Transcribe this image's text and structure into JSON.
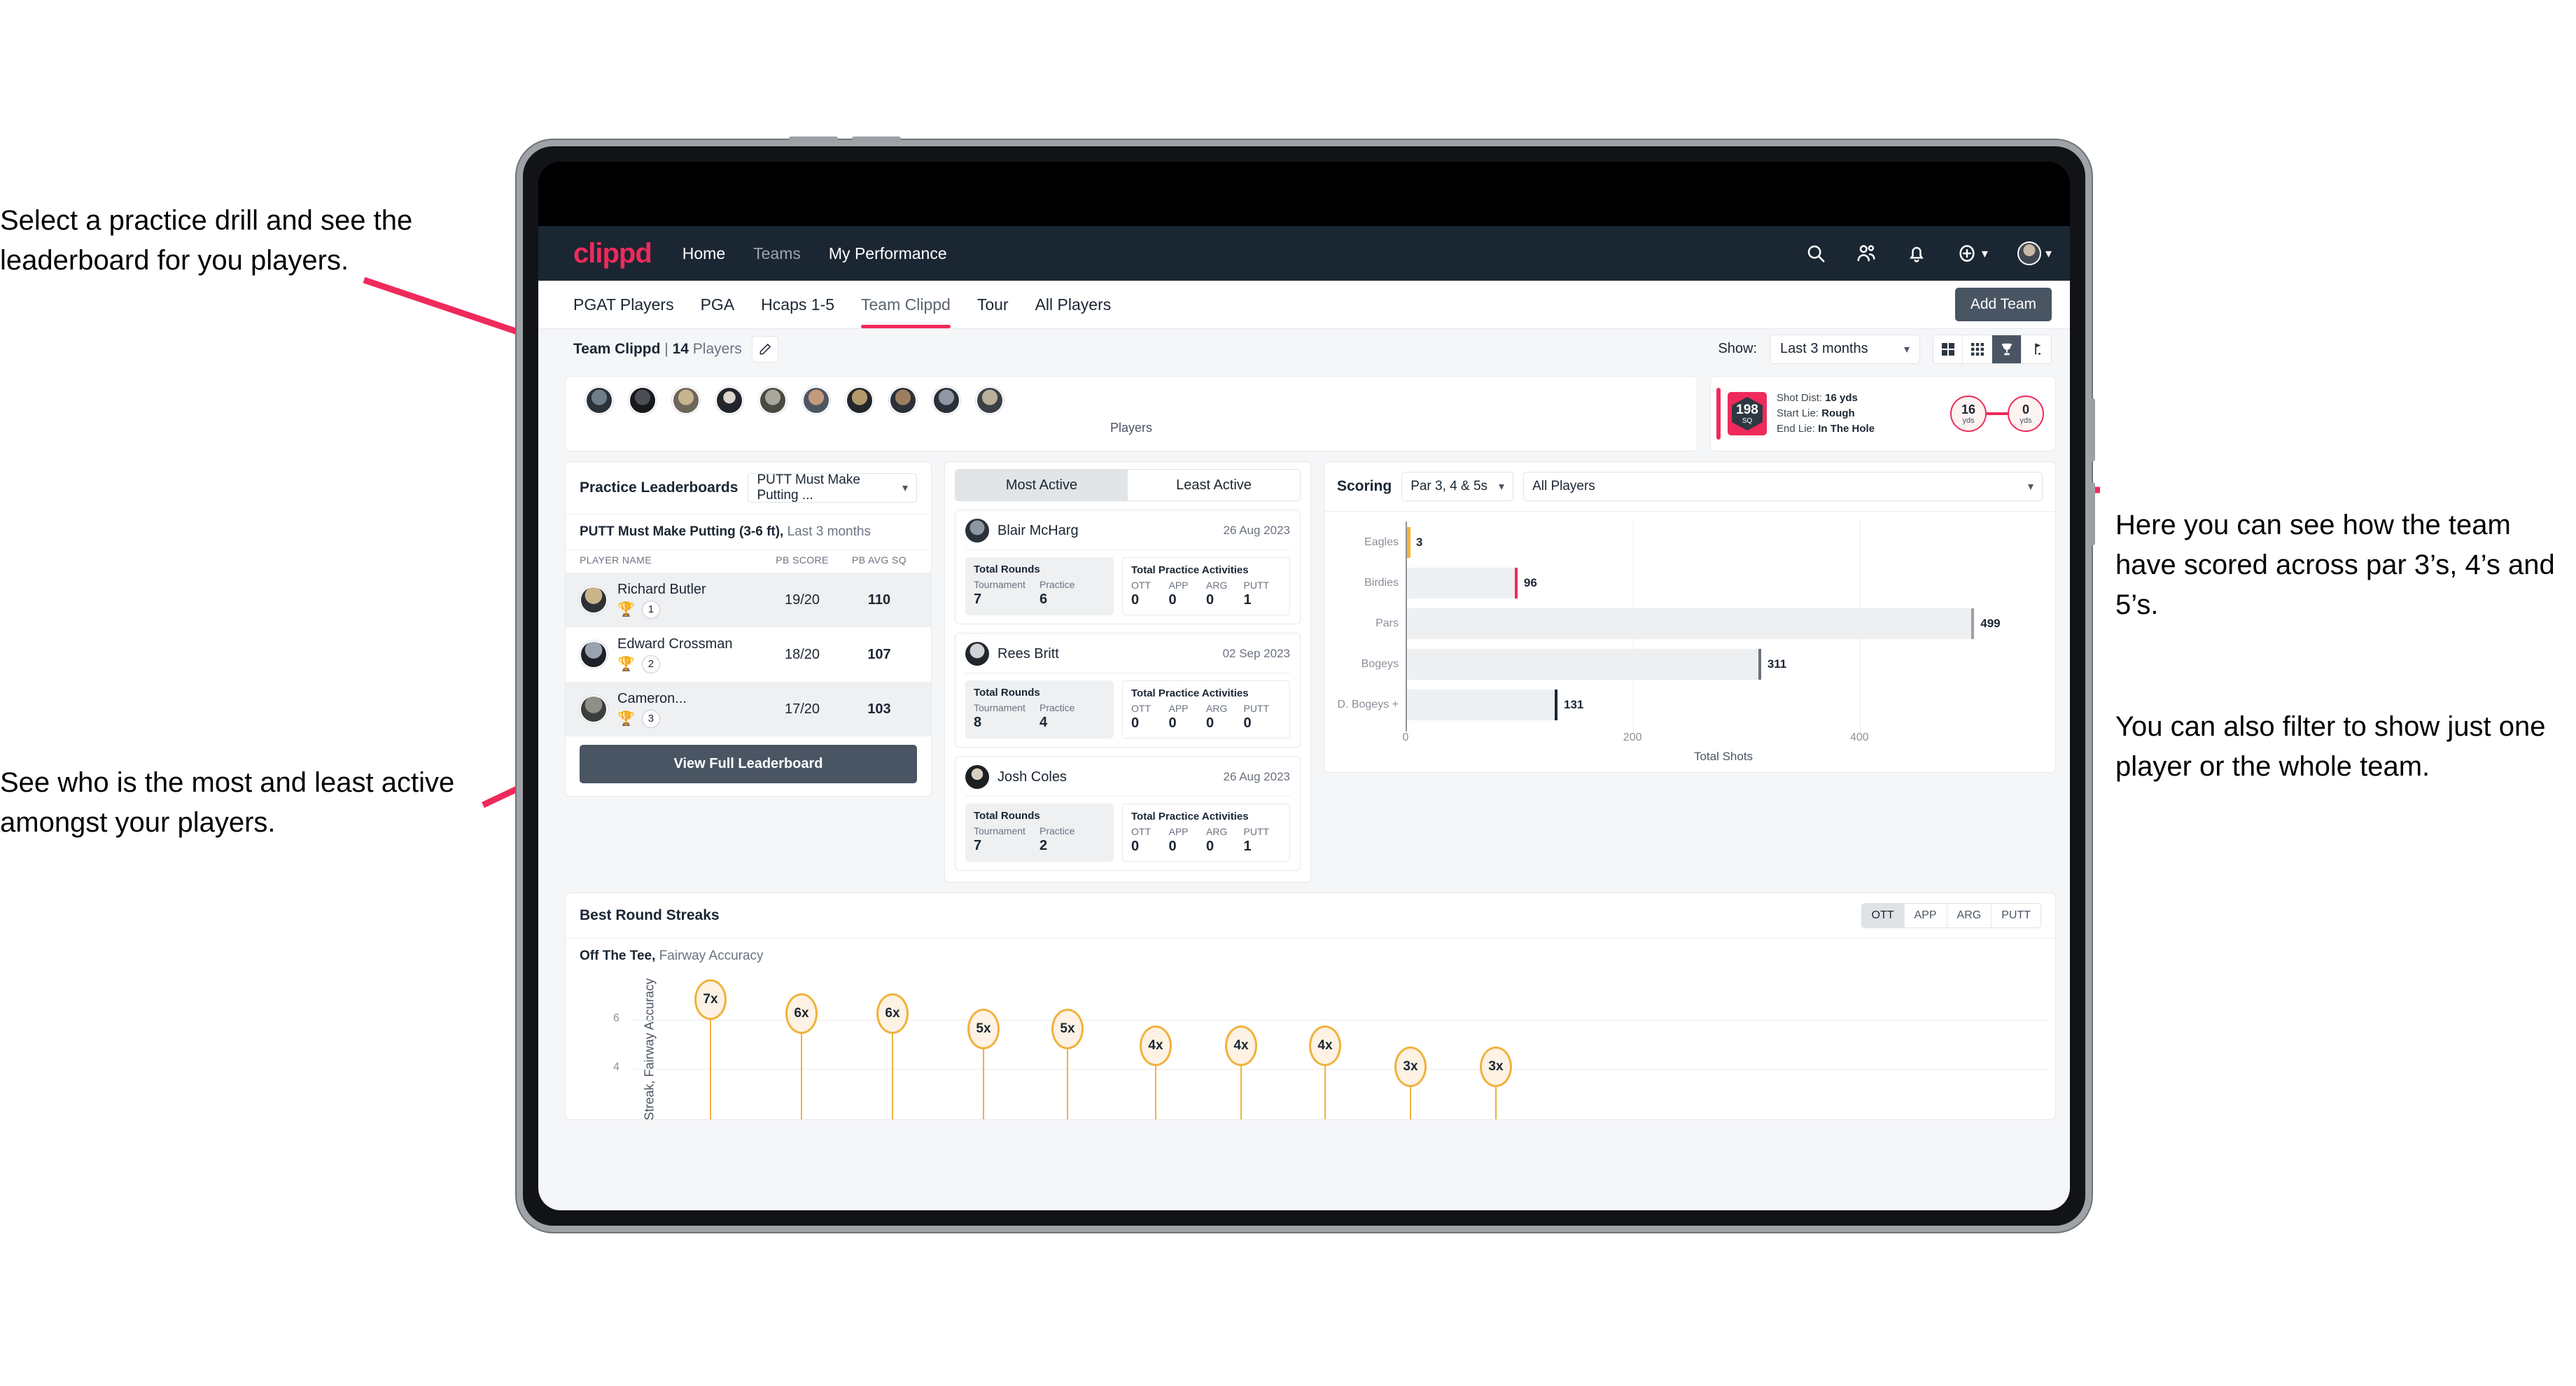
{
  "annotations": [
    {
      "id": "a1",
      "text": "Select a practice drill and see the leaderboard for you players."
    },
    {
      "id": "a2",
      "text": "See who is the most and least active amongst your players."
    },
    {
      "id": "a3",
      "text": "Here you can see how the team have scored across par 3’s, 4’s and 5’s."
    },
    {
      "id": "a4",
      "text": "You can also filter to show just one player or the whole team."
    }
  ],
  "navbar": {
    "logo": "clippd",
    "links": [
      {
        "label": "Home",
        "active": true
      },
      {
        "label": "Teams",
        "active": false
      },
      {
        "label": "My Performance",
        "active": true
      }
    ],
    "icons": [
      "search-icon",
      "people-icon",
      "bell-icon",
      "plus-circle-icon",
      "avatar-icon"
    ]
  },
  "tabs": [
    {
      "label": "PGAT Players",
      "active": false
    },
    {
      "label": "PGA",
      "active": false
    },
    {
      "label": "Hcaps 1-5",
      "active": false
    },
    {
      "label": "Team Clippd",
      "active": true
    },
    {
      "label": "Tour",
      "active": false
    },
    {
      "label": "All Players",
      "active": false
    }
  ],
  "add_team_label": "Add Team",
  "subbar": {
    "team_name": "Team Clippd",
    "separator": "|",
    "player_count": "14",
    "players_word": "Players",
    "show_label": "Show:",
    "range_value": "Last 3 months",
    "view_toggles": [
      {
        "name": "grid-view-icon",
        "active": false
      },
      {
        "name": "dots-grid-view-icon",
        "active": false
      },
      {
        "name": "trophy-view-icon",
        "active": true
      },
      {
        "name": "flag-view-icon",
        "active": false
      }
    ]
  },
  "players_strip": {
    "label": "Players",
    "count": 10
  },
  "shot_card": {
    "sq_value": "198",
    "sq_unit": "SQ",
    "lines": [
      {
        "label": "Shot Dist:",
        "value": "16 yds"
      },
      {
        "label": "Start Lie:",
        "value": "Rough"
      },
      {
        "label": "End Lie:",
        "value": "In The Hole"
      }
    ],
    "start_value": "16",
    "start_unit": "yds",
    "end_value": "0",
    "end_unit": "yds"
  },
  "leaderboard": {
    "title": "Practice Leaderboards",
    "drill_select": "PUTT Must Make Putting ...",
    "subtitle_bold": "PUTT Must Make Putting (3-6 ft),",
    "subtitle_light": "Last 3 months",
    "columns": [
      "PLAYER NAME",
      "PB SCORE",
      "PB AVG SQ"
    ],
    "rows": [
      {
        "name": "Richard Butler",
        "rank": "1",
        "trophy": "gold",
        "score": "19/20",
        "avg": "110"
      },
      {
        "name": "Edward Crossman",
        "rank": "2",
        "trophy": "silver",
        "score": "18/20",
        "avg": "107"
      },
      {
        "name": "Cameron...",
        "rank": "3",
        "trophy": "bronze",
        "score": "17/20",
        "avg": "103"
      }
    ],
    "button": "View Full Leaderboard"
  },
  "activity": {
    "tabs": [
      {
        "label": "Most Active",
        "active": true
      },
      {
        "label": "Least Active",
        "active": false
      }
    ],
    "rounds_title": "Total Rounds",
    "rounds_keys": [
      "Tournament",
      "Practice"
    ],
    "acts_title": "Total Practice Activities",
    "acts_keys": [
      "OTT",
      "APP",
      "ARG",
      "PUTT"
    ],
    "items": [
      {
        "name": "Blair McHarg",
        "date": "26 Aug 2023",
        "tournament": "7",
        "practice": "6",
        "ott": "0",
        "app": "0",
        "arg": "0",
        "putt": "1"
      },
      {
        "name": "Rees Britt",
        "date": "02 Sep 2023",
        "tournament": "8",
        "practice": "4",
        "ott": "0",
        "app": "0",
        "arg": "0",
        "putt": "0"
      },
      {
        "name": "Josh Coles",
        "date": "26 Aug 2023",
        "tournament": "7",
        "practice": "2",
        "ott": "0",
        "app": "0",
        "arg": "0",
        "putt": "1"
      }
    ]
  },
  "scoring": {
    "title": "Scoring",
    "par_select": "Par 3, 4 & 5s",
    "players_select": "All Players"
  },
  "streaks": {
    "title": "Best Round Streaks",
    "segments": [
      {
        "label": "OTT",
        "active": true
      },
      {
        "label": "APP",
        "active": false
      },
      {
        "label": "ARG",
        "active": false
      },
      {
        "label": "PUTT",
        "active": false
      }
    ],
    "sub_bold": "Off The Tee,",
    "sub_light": "Fairway Accuracy"
  },
  "chart_data": [
    {
      "type": "bar",
      "orientation": "horizontal",
      "title": "Scoring",
      "categories": [
        "Eagles",
        "Birdies",
        "Pars",
        "Bogeys",
        "D. Bogeys +"
      ],
      "values": [
        3,
        96,
        499,
        311,
        131
      ],
      "bar_colors": [
        "#f5b335",
        "#edeff1",
        "#edeff1",
        "#edeff1",
        "#edeff1"
      ],
      "cap_colors": [
        "#f5b335",
        "#ef2a5b",
        "#9aa0a7",
        "#6b7280",
        "#1b2633"
      ],
      "xlabel": "Total Shots",
      "ylabel": "",
      "xlim": [
        0,
        560
      ],
      "xticks": [
        0,
        200,
        400
      ],
      "grid": true,
      "legend": "none"
    },
    {
      "type": "bar",
      "orientation": "vertical",
      "title": "Best Round Streaks",
      "subtitle": "Off The Tee, Fairway Accuracy",
      "ylabel": "Streak, Fairway Accuracy",
      "xlabel": "",
      "ylim": [
        0,
        8
      ],
      "yticks": [
        4,
        6
      ],
      "grid": true,
      "categories": [
        "",
        "",
        "",
        "",
        "",
        "",
        "",
        "",
        "",
        ""
      ],
      "values": [
        7,
        6,
        6,
        5,
        5,
        4,
        4,
        4,
        3,
        3
      ],
      "labels": [
        "7x",
        "6x",
        "6x",
        "5x",
        "5x",
        "4x",
        "4x",
        "4x",
        "3x",
        "3x"
      ],
      "marker_color": "#f0b23c",
      "marker_fill": "#fdf2e3"
    }
  ]
}
